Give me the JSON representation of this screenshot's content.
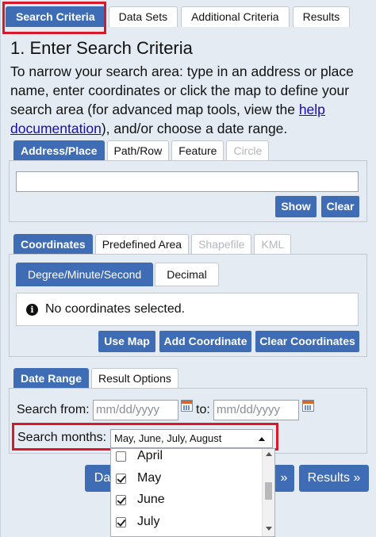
{
  "top_tabs": [
    "Search Criteria",
    "Data Sets",
    "Additional Criteria",
    "Results"
  ],
  "heading": "1. Enter Search Criteria",
  "intro": {
    "text_before": "To narrow your search area: type in an address or place name, enter coordinates or click the map to define your search area (for advanced map tools, view the ",
    "link_help": "help",
    "link_doc": "documentation",
    "text_after": "), and/or choose a date range."
  },
  "address_tabs": [
    "Address/Place",
    "Path/Row",
    "Feature",
    "Circle"
  ],
  "address": {
    "value": "",
    "show_label": "Show",
    "clear_label": "Clear"
  },
  "coord_tabs": [
    "Coordinates",
    "Predefined Area",
    "Shapefile",
    "KML"
  ],
  "coord_subtabs": [
    "Degree/Minute/Second",
    "Decimal"
  ],
  "coord_info": "No coordinates selected.",
  "coord_buttons": {
    "use_map": "Use Map",
    "add_coordinate": "Add Coordinate",
    "clear_coordinates": "Clear Coordinates"
  },
  "date_tabs": [
    "Date Range",
    "Result Options"
  ],
  "date": {
    "search_from_label": "Search from:",
    "from_placeholder": "mm/dd/yyyy",
    "to_label": "to:",
    "to_placeholder": "mm/dd/yyyy",
    "months_label": "Search months:",
    "months_value": "May, June, July, August"
  },
  "months_options": [
    {
      "label": "April",
      "checked": false
    },
    {
      "label": "May",
      "checked": true
    },
    {
      "label": "June",
      "checked": true
    },
    {
      "label": "July",
      "checked": true
    }
  ],
  "nav": {
    "data_sets_partial": "Da",
    "additional_partial": "»",
    "results": "Results »"
  },
  "colors": {
    "accent": "#3f6db5",
    "highlight": "#d7192a",
    "panel_bg": "#e4ebf2"
  }
}
